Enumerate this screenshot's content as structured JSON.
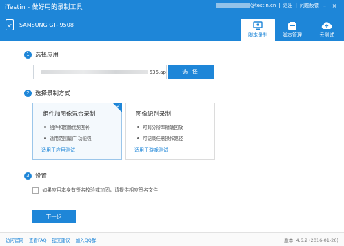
{
  "header": {
    "app_title": "iTestin - 做好用的录制工具",
    "user_email": "@testin.cn",
    "logout": "退出",
    "feedback": "问题反馈",
    "device_name": "SAMSUNG GT-I9508",
    "tabs": [
      {
        "label": "脚本录制",
        "icon": "record-icon",
        "active": true
      },
      {
        "label": "脚本管理",
        "icon": "manage-icon",
        "active": false
      },
      {
        "label": "云测试",
        "icon": "cloud-icon",
        "active": false
      }
    ]
  },
  "step1": {
    "num": "1",
    "title": "选择应用",
    "file_suffix": "535.ap",
    "choose_label": "选 择"
  },
  "step2": {
    "num": "2",
    "title": "选择录制方式",
    "modes": [
      {
        "title": "组件加图像混合录制",
        "bullets": [
          "组件和图像优势互补",
          "适用范围最广 功能强"
        ],
        "link": "适用于应用测试",
        "selected": true
      },
      {
        "title": "图像识别录制",
        "bullets": [
          "可跨分辨率精确回放",
          "可记录任意操作路径"
        ],
        "link": "适用于游戏测试",
        "selected": false
      }
    ]
  },
  "step3": {
    "num": "3",
    "title": "设置",
    "checkbox_label": "如果应用本身有签名校验或加固，请提供相应签名文件"
  },
  "next_label": "下一步",
  "footer": {
    "links": [
      "访问官网",
      "查看FAQ",
      "提交建议",
      "加入QQ群"
    ],
    "version": "版本: 4.6.2 (2016-01-26)"
  },
  "colors": {
    "accent": "#1e86d8"
  }
}
